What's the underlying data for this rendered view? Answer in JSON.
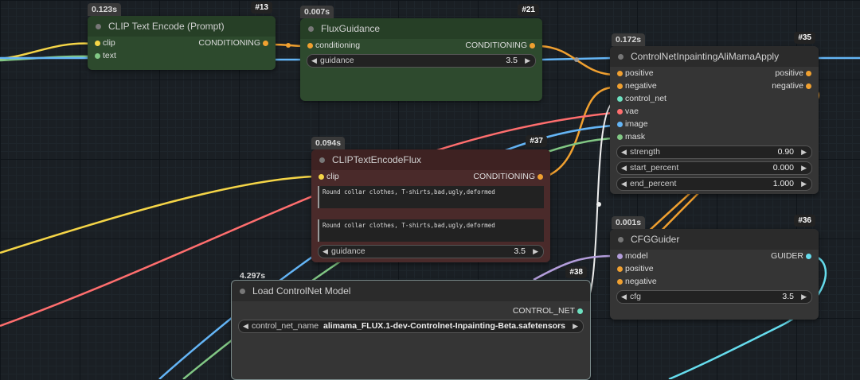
{
  "nodes": {
    "clip_encode": {
      "timing": "0.123s",
      "id": "#13",
      "title": "CLIP Text Encode (Prompt)",
      "inputs": [
        "clip",
        "text"
      ],
      "output": "CONDITIONING"
    },
    "flux_guidance": {
      "timing": "0.007s",
      "id": "#21",
      "title": "FluxGuidance",
      "input": "conditioning",
      "output": "CONDITIONING",
      "widget": {
        "label": "guidance",
        "value": "3.5"
      }
    },
    "controlnet_apply": {
      "timing": "0.172s",
      "id": "#35",
      "title": "ControlNetInpaintingAliMamaApply",
      "inputs": [
        "positive",
        "negative",
        "control_net",
        "vae",
        "image",
        "mask"
      ],
      "outputs": [
        "positive",
        "negative"
      ],
      "widgets": [
        {
          "label": "strength",
          "value": "0.90"
        },
        {
          "label": "start_percent",
          "value": "0.000"
        },
        {
          "label": "end_percent",
          "value": "1.000"
        }
      ]
    },
    "clip_flux": {
      "timing": "0.094s",
      "id": "#37",
      "title": "CLIPTextEncodeFlux",
      "input": "clip",
      "output": "CONDITIONING",
      "text1": "Round collar clothes, T-shirts,bad,ugly,deformed",
      "text2": "Round collar clothes, T-shirts,bad,ugly,deformed",
      "widget": {
        "label": "guidance",
        "value": "3.5"
      }
    },
    "cfg_guider": {
      "timing": "0.001s",
      "id": "#36",
      "title": "CFGGuider",
      "inputs": [
        "model",
        "positive",
        "negative"
      ],
      "output": "GUIDER",
      "widget": {
        "label": "cfg",
        "value": "3.5"
      }
    },
    "load_controlnet": {
      "timing": "4.297s",
      "id": "#38",
      "title": "Load ControlNet Model",
      "output": "CONTROL_NET",
      "widget": {
        "label": "control_net_name",
        "value": "alimama_FLUX.1-dev-Controlnet-Inpainting-Beta.safetensors"
      }
    }
  },
  "colors": {
    "clip": "#f5d547",
    "conditioning": "#f0a030",
    "control_net": "#6de0c0",
    "vae": "#ff6e6e",
    "image": "#64b5f6",
    "mask": "#81c784",
    "model": "#b39ddb",
    "guider": "#66ddee"
  }
}
